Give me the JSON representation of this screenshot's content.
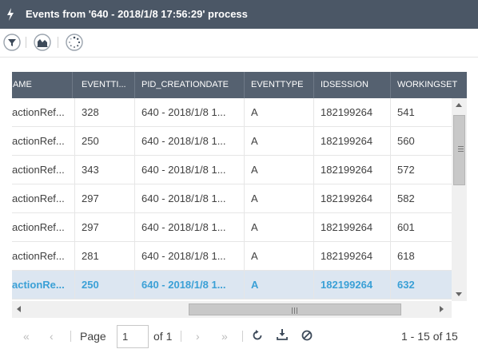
{
  "window": {
    "title": "Events from '640 - 2018/1/8 17:56:29' process"
  },
  "toolbar": {
    "filter_icon": "filter-icon",
    "chart_icon": "area-chart-icon",
    "loading_icon": "spinner-icon"
  },
  "table": {
    "columns": [
      "NAME",
      "EVENTTI...",
      "PID_CREATIONDATE",
      "EVENTTYPE",
      "IDSESSION",
      "WORKINGSET"
    ],
    "rows": [
      [
        "actionRef...",
        "328",
        "640 - 2018/1/8 1...",
        "A",
        "182199264",
        "541"
      ],
      [
        "actionRef...",
        "250",
        "640 - 2018/1/8 1...",
        "A",
        "182199264",
        "560"
      ],
      [
        "actionRef...",
        "343",
        "640 - 2018/1/8 1...",
        "A",
        "182199264",
        "572"
      ],
      [
        "actionRef...",
        "297",
        "640 - 2018/1/8 1...",
        "A",
        "182199264",
        "582"
      ],
      [
        "actionRef...",
        "297",
        "640 - 2018/1/8 1...",
        "A",
        "182199264",
        "601"
      ],
      [
        "actionRef...",
        "281",
        "640 - 2018/1/8 1...",
        "A",
        "182199264",
        "618"
      ],
      [
        "actionRe...",
        "250",
        "640 - 2018/1/8 1...",
        "A",
        "182199264",
        "632"
      ]
    ],
    "selected_row": 6
  },
  "pager": {
    "first": "«",
    "prev": "‹",
    "page_label": "Page",
    "page_value": "1",
    "of_label": "of 1",
    "next": "›",
    "last": "»",
    "summary": "1 - 15 of 15"
  },
  "colors": {
    "titlebar": "#4b5766",
    "header": "#556170",
    "selected_text": "#3aa0d6",
    "selected_bg": "#dce6f1"
  }
}
